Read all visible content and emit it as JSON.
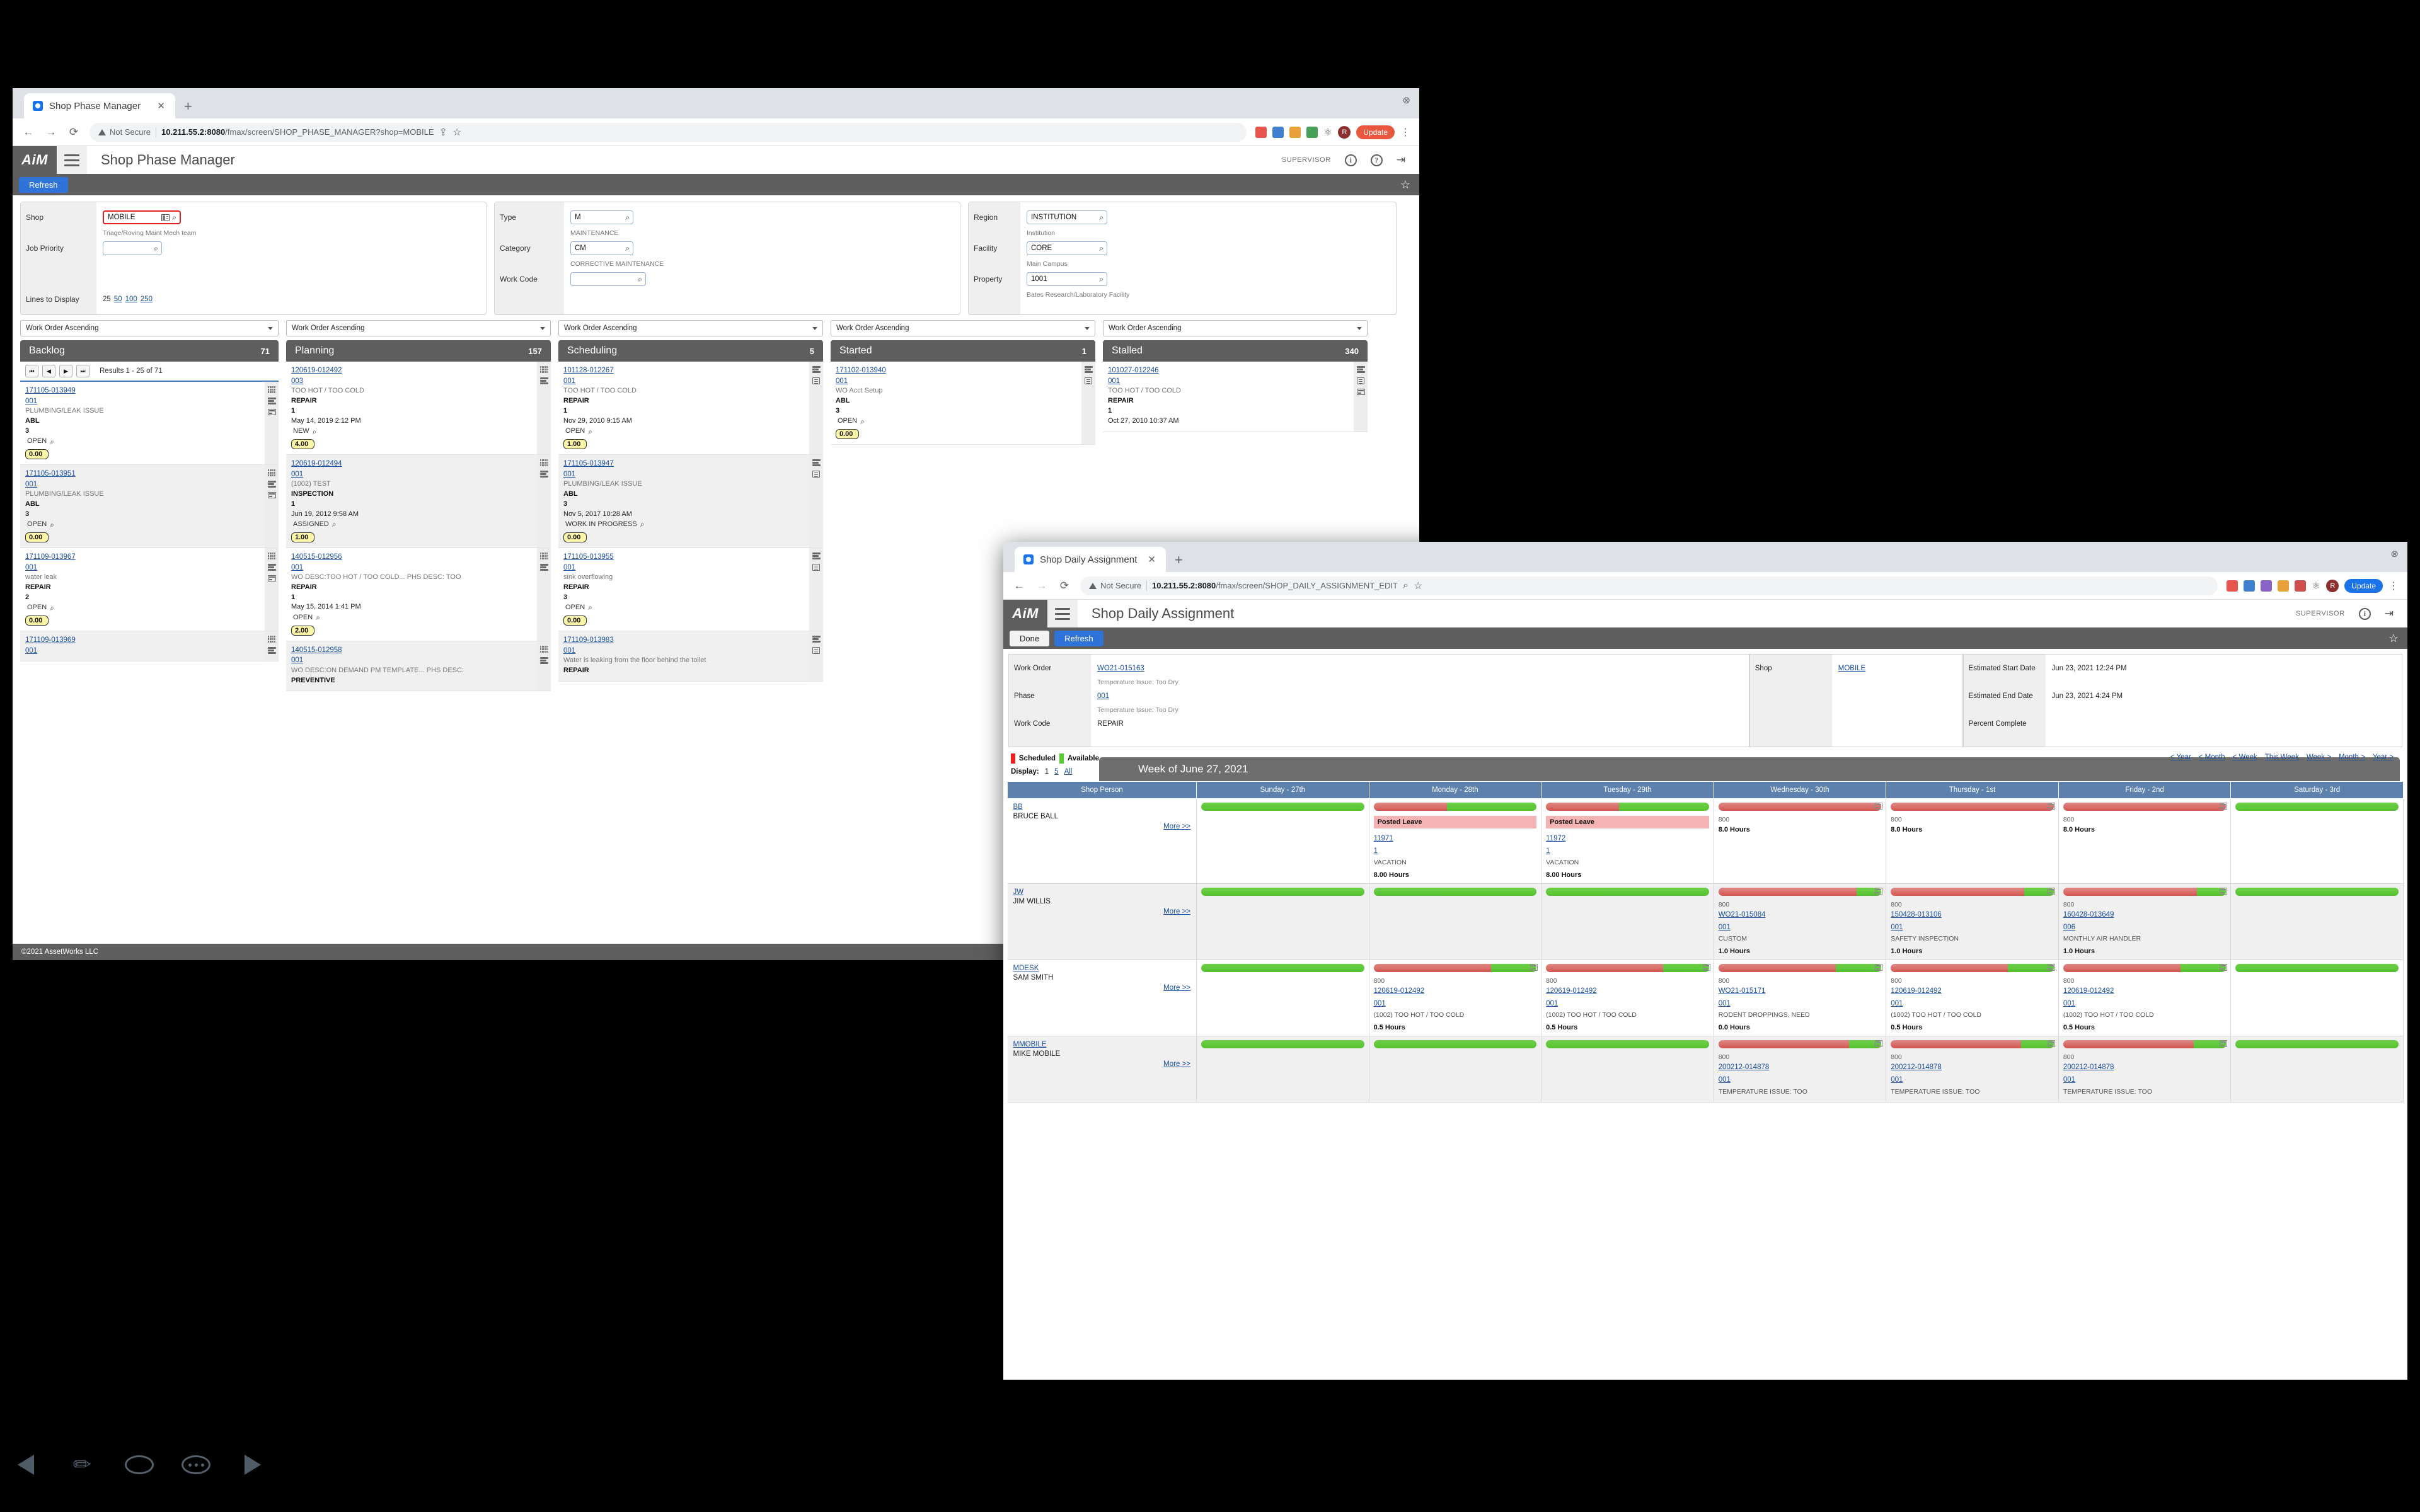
{
  "window1": {
    "tab": {
      "title": "Shop Phase Manager",
      "close": "✕",
      "newtab": "+"
    },
    "omnibox": {
      "security": "Not Secure",
      "host": "10.211.55.2:8080",
      "path": "/fmax/screen/SHOP_PHASE_MANAGER?shop=MOBILE"
    },
    "toolbar": {
      "update_label": "Update",
      "avatar": "R"
    },
    "app": {
      "logo": "AiM",
      "title": "Shop Phase Manager",
      "role": "SUPERVISOR",
      "info_icon": "i",
      "help_icon": "?"
    },
    "actions": {
      "refresh": "Refresh"
    },
    "filters": {
      "left": {
        "shop_label": "Shop",
        "shop_value": "MOBILE",
        "shop_sub": "Triage/Roving Maint Mech team",
        "priority_label": "Job Priority",
        "priority_value": "",
        "lines_label": "Lines to Display",
        "lines_current": "25",
        "lines_options": [
          "50",
          "100",
          "250"
        ]
      },
      "middle": {
        "type_label": "Type",
        "type_value": "M",
        "type_sub": "MAINTENANCE",
        "category_label": "Category",
        "category_value": "CM",
        "category_sub": "CORRECTIVE MAINTENANCE",
        "workcode_label": "Work Code",
        "workcode_value": ""
      },
      "right": {
        "region_label": "Region",
        "region_value": "INSTITUTION",
        "region_sub": "Institution",
        "facility_label": "Facility",
        "facility_value": "CORE",
        "facility_sub": "Main Campus",
        "property_label": "Property",
        "property_value": "1001",
        "property_sub": "Bates Research/Laboratory Facility"
      }
    },
    "sort_label": "Work Order Ascending",
    "pager": {
      "first": "⏮",
      "prev": "◀",
      "next": "▶",
      "last": "⏭",
      "results": "Results 1 - 25 of 71"
    },
    "columns": [
      {
        "title": "Backlog",
        "count": "71",
        "has_pager": true,
        "cards": [
          {
            "wo": "171105-013949",
            "phase": "001",
            "desc": "PLUMBING/LEAK ISSUE",
            "code": "ABL",
            "pri": "3",
            "date": "",
            "status": "OPEN",
            "hours": "0.00",
            "rail": [
              "grid",
              "bars",
              "card"
            ]
          },
          {
            "wo": "171105-013951",
            "phase": "001",
            "desc": "PLUMBING/LEAK ISSUE",
            "code": "ABL",
            "pri": "3",
            "date": "",
            "status": "OPEN",
            "hours": "0.00",
            "rail": [
              "grid",
              "bars",
              "card"
            ]
          },
          {
            "wo": "171109-013967",
            "phase": "001",
            "desc": "water leak",
            "code": "REPAIR",
            "pri": "2",
            "date": "",
            "status": "OPEN",
            "hours": "0.00",
            "rail": [
              "grid",
              "bars",
              "card"
            ]
          },
          {
            "wo": "171109-013969",
            "phase": "001",
            "desc": "",
            "code": "",
            "pri": "",
            "date": "",
            "status": "",
            "hours": "",
            "rail": [
              "grid",
              "bars"
            ]
          }
        ]
      },
      {
        "title": "Planning",
        "count": "157",
        "has_pager": false,
        "cards": [
          {
            "wo": "120619-012492",
            "phase": "003",
            "desc": "TOO HOT / TOO COLD",
            "code": "REPAIR",
            "pri": "1",
            "date": "May 14, 2019 2:12 PM",
            "status": "NEW",
            "hours": "4.00",
            "rail": [
              "grid",
              "bars"
            ]
          },
          {
            "wo": "120619-012494",
            "phase": "001",
            "desc": "(1002) TEST",
            "code": "INSPECTION",
            "pri": "1",
            "date": "Jun 19, 2012 9:58 AM",
            "status": "ASSIGNED",
            "hours": "1.00",
            "rail": [
              "grid",
              "bars"
            ]
          },
          {
            "wo": "140515-012956",
            "phase": "001",
            "desc": "WO DESC:TOO HOT / TOO COLD... PHS DESC: TOO",
            "code": "REPAIR",
            "pri": "1",
            "date": "May 15, 2014 1:41 PM",
            "status": "OPEN",
            "hours": "2.00",
            "rail": [
              "grid",
              "bars"
            ]
          },
          {
            "wo": "140515-012958",
            "phase": "001",
            "desc": "WO DESC:ON DEMAND PM TEMPLATE... PHS DESC:",
            "code": "PREVENTIVE",
            "pri": "",
            "date": "",
            "status": "",
            "hours": "",
            "rail": [
              "grid",
              "bars"
            ]
          }
        ]
      },
      {
        "title": "Scheduling",
        "count": "5",
        "has_pager": false,
        "cards": [
          {
            "wo": "101128-012267",
            "phase": "001",
            "desc": "TOO HOT / TOO COLD",
            "code": "REPAIR",
            "pri": "1",
            "date": "Nov 29, 2010 9:15 AM",
            "status": "OPEN",
            "hours": "1.00",
            "rail": [
              "bars",
              "lines"
            ]
          },
          {
            "wo": "171105-013947",
            "phase": "001",
            "desc": "PLUMBING/LEAK ISSUE",
            "code": "ABL",
            "pri": "3",
            "date": "Nov 5, 2017 10:28 AM",
            "status": "WORK IN PROGRESS",
            "hours": "0.00",
            "rail": [
              "bars",
              "lines"
            ]
          },
          {
            "wo": "171105-013955",
            "phase": "001",
            "desc": "sink overflowing",
            "code": "REPAIR",
            "pri": "3",
            "date": "",
            "status": "OPEN",
            "hours": "0.00",
            "rail": [
              "bars",
              "lines"
            ]
          },
          {
            "wo": "171109-013983",
            "phase": "001",
            "desc": "Water is leaking from the floor behind the toilet",
            "code": "REPAIR",
            "pri": "",
            "date": "",
            "status": "",
            "hours": "",
            "rail": [
              "bars",
              "lines"
            ]
          }
        ]
      },
      {
        "title": "Started",
        "count": "1",
        "has_pager": false,
        "cards": [
          {
            "wo": "171102-013940",
            "phase": "001",
            "desc": "WO Acct Setup",
            "code": "ABL",
            "pri": "3",
            "date": "",
            "status": "OPEN",
            "hours": "0.00",
            "rail": [
              "bars",
              "lines"
            ]
          }
        ]
      },
      {
        "title": "Stalled",
        "count": "340",
        "has_pager": false,
        "cards": [
          {
            "wo": "101027-012246",
            "phase": "001",
            "desc": "TOO HOT / TOO COLD",
            "code": "REPAIR",
            "pri": "1",
            "date": "Oct 27, 2010 10:37 AM",
            "status": "",
            "hours": "",
            "rail": [
              "bars",
              "lines",
              "card"
            ]
          }
        ]
      }
    ],
    "footer": "©2021 AssetWorks LLC"
  },
  "window2": {
    "tab": {
      "title": "Shop Daily Assignment",
      "close": "✕",
      "newtab": "+"
    },
    "omnibox": {
      "security": "Not Secure",
      "host": "10.211.55.2:8080",
      "path": "/fmax/screen/SHOP_DAILY_ASSIGNMENT_EDIT"
    },
    "toolbar": {
      "update_label": "Update",
      "avatar": "R"
    },
    "app": {
      "logo": "AiM",
      "title": "Shop Daily Assignment",
      "role": "SUPERVISOR",
      "info_icon": "i"
    },
    "actions": {
      "done": "Done",
      "refresh": "Refresh"
    },
    "detail": {
      "col1": [
        {
          "label": "Work Order",
          "value": "WO21-015163",
          "link": true,
          "sub": "Temperature Issue: Too Dry"
        },
        {
          "label": "Phase",
          "value": "001",
          "link": true,
          "sub": "Temperature Issue: Too Dry"
        },
        {
          "label": "Work Code",
          "value": "REPAIR",
          "link": false,
          "sub": ""
        }
      ],
      "col2": [
        {
          "label": "Shop",
          "value": "MOBILE",
          "link": true,
          "sub": ""
        }
      ],
      "col3": [
        {
          "label": "Estimated Start Date",
          "value": "Jun 23, 2021 12:24 PM",
          "link": false,
          "sub": ""
        },
        {
          "label": "Estimated End Date",
          "value": "Jun 23, 2021 4:24 PM",
          "link": false,
          "sub": ""
        },
        {
          "label": "Percent Complete",
          "value": "",
          "link": false,
          "sub": ""
        }
      ]
    },
    "legend": [
      {
        "label": "Scheduled",
        "color": "#f01f1f"
      },
      {
        "label": "Available",
        "color": "#55cc2e"
      }
    ],
    "display": {
      "label": "Display:",
      "current": "1",
      "options": [
        "5",
        "All"
      ]
    },
    "weeknav": [
      "< Year",
      "< Month",
      "< Week",
      "This Week",
      "Week >",
      "Month >",
      "Year >"
    ],
    "week_title": "Week of June 27, 2021",
    "calendar": {
      "headers": [
        "Shop Person",
        "Sunday - 27th",
        "Monday - 28th",
        "Tuesday - 29th",
        "Wednesday - 30th",
        "Thursday - 1st",
        "Friday - 2nd",
        "Saturday - 3rd"
      ],
      "more_label": "More >>",
      "rows": [
        {
          "person_id": "BB",
          "person_name": "BRUCE BALL",
          "days": [
            {
              "red": 0,
              "green": 100,
              "leave": "",
              "shop": "",
              "wo": "",
              "phase": "",
              "desc": "",
              "hours": ""
            },
            {
              "red": 45,
              "green": 55,
              "leave": "Posted Leave",
              "shop": "",
              "wo": "11971",
              "phase": "1",
              "desc": "VACATION",
              "hours": "8.00 Hours"
            },
            {
              "red": 45,
              "green": 55,
              "leave": "Posted Leave",
              "shop": "",
              "wo": "11972",
              "phase": "1",
              "desc": "VACATION",
              "hours": "8.00 Hours"
            },
            {
              "red": 100,
              "green": 0,
              "leave": "",
              "shop": "800",
              "wo": "",
              "phase": "",
              "desc": "",
              "hours": "8.0 Hours"
            },
            {
              "red": 100,
              "green": 0,
              "leave": "",
              "shop": "800",
              "wo": "",
              "phase": "",
              "desc": "",
              "hours": "8.0 Hours"
            },
            {
              "red": 100,
              "green": 0,
              "leave": "",
              "shop": "800",
              "wo": "",
              "phase": "",
              "desc": "",
              "hours": "8.0 Hours"
            },
            {
              "red": 0,
              "green": 100,
              "leave": "",
              "shop": "",
              "wo": "",
              "phase": "",
              "desc": "",
              "hours": ""
            }
          ]
        },
        {
          "person_id": "JW",
          "person_name": "JIM WILLIS",
          "days": [
            {
              "red": 0,
              "green": 100,
              "leave": "",
              "shop": "",
              "wo": "",
              "phase": "",
              "desc": "",
              "hours": ""
            },
            {
              "red": 0,
              "green": 100,
              "leave": "",
              "shop": "",
              "wo": "",
              "phase": "",
              "desc": "",
              "hours": ""
            },
            {
              "red": 0,
              "green": 100,
              "leave": "",
              "shop": "",
              "wo": "",
              "phase": "",
              "desc": "",
              "hours": ""
            },
            {
              "red": 85,
              "green": 15,
              "leave": "",
              "shop": "800",
              "wo": "WO21-015084",
              "phase": "001",
              "desc": "CUSTOM",
              "hours": "1.0 Hours"
            },
            {
              "red": 82,
              "green": 18,
              "leave": "",
              "shop": "800",
              "wo": "150428-013106",
              "phase": "001",
              "desc": "SAFETY INSPECTION",
              "hours": "1.0 Hours"
            },
            {
              "red": 82,
              "green": 18,
              "leave": "",
              "shop": "800",
              "wo": "160428-013649",
              "phase": "006",
              "desc": "MONTHLY AIR HANDLER",
              "hours": "1.0 Hours"
            },
            {
              "red": 0,
              "green": 100,
              "leave": "",
              "shop": "",
              "wo": "",
              "phase": "",
              "desc": "",
              "hours": ""
            }
          ]
        },
        {
          "person_id": "MDESK",
          "person_name": "SAM SMITH",
          "days": [
            {
              "red": 0,
              "green": 100,
              "leave": "",
              "shop": "",
              "wo": "",
              "phase": "",
              "desc": "",
              "hours": ""
            },
            {
              "red": 72,
              "green": 28,
              "leave": "",
              "shop": "800",
              "wo": "120619-012492",
              "phase": "001",
              "desc": "(1002) TOO HOT / TOO COLD",
              "hours": "0.5 Hours"
            },
            {
              "red": 72,
              "green": 28,
              "leave": "",
              "shop": "800",
              "wo": "120619-012492",
              "phase": "001",
              "desc": "(1002) TOO HOT / TOO COLD",
              "hours": "0.5 Hours"
            },
            {
              "red": 72,
              "green": 28,
              "leave": "",
              "shop": "800",
              "wo": "WO21-015171",
              "phase": "001",
              "desc": "RODENT DROPPINGS, NEED",
              "hours": "0.0 Hours"
            },
            {
              "red": 72,
              "green": 28,
              "leave": "",
              "shop": "800",
              "wo": "120619-012492",
              "phase": "001",
              "desc": "(1002) TOO HOT / TOO COLD",
              "hours": "0.5 Hours"
            },
            {
              "red": 72,
              "green": 28,
              "leave": "",
              "shop": "800",
              "wo": "120619-012492",
              "phase": "001",
              "desc": "(1002) TOO HOT / TOO COLD",
              "hours": "0.5 Hours"
            },
            {
              "red": 0,
              "green": 100,
              "leave": "",
              "shop": "",
              "wo": "",
              "phase": "",
              "desc": "",
              "hours": ""
            }
          ]
        },
        {
          "person_id": "MMOBILE",
          "person_name": "MIKE MOBILE",
          "days": [
            {
              "red": 0,
              "green": 100,
              "leave": "",
              "shop": "",
              "wo": "",
              "phase": "",
              "desc": "",
              "hours": ""
            },
            {
              "red": 0,
              "green": 100,
              "leave": "",
              "shop": "",
              "wo": "",
              "phase": "",
              "desc": "",
              "hours": ""
            },
            {
              "red": 0,
              "green": 100,
              "leave": "",
              "shop": "",
              "wo": "",
              "phase": "",
              "desc": "",
              "hours": ""
            },
            {
              "red": 80,
              "green": 20,
              "leave": "",
              "shop": "800",
              "wo": "200212-014878",
              "phase": "001",
              "desc": "TEMPERATURE ISSUE: TOO",
              "hours": ""
            },
            {
              "red": 80,
              "green": 20,
              "leave": "",
              "shop": "800",
              "wo": "200212-014878",
              "phase": "001",
              "desc": "TEMPERATURE ISSUE: TOO",
              "hours": ""
            },
            {
              "red": 80,
              "green": 20,
              "leave": "",
              "shop": "800",
              "wo": "200212-014878",
              "phase": "001",
              "desc": "TEMPERATURE ISSUE: TOO",
              "hours": ""
            },
            {
              "red": 0,
              "green": 100,
              "leave": "",
              "shop": "",
              "wo": "",
              "phase": "",
              "desc": "",
              "hours": ""
            }
          ]
        }
      ]
    }
  }
}
